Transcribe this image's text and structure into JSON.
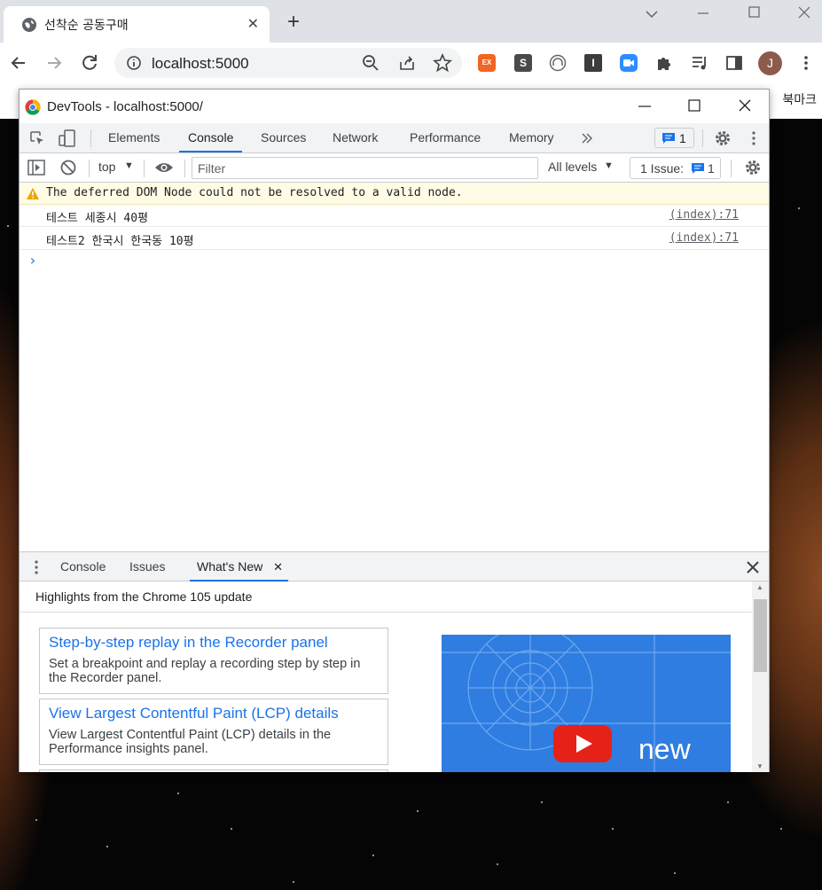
{
  "browser": {
    "tab_title": "선착순 공동구매",
    "url": "localhost:5000",
    "bookmarks_label": "북마크",
    "profile_initial": "J",
    "extension_ex_label": "EX",
    "extension_s_label": "S",
    "extension_i_label": "I"
  },
  "devtools": {
    "window_title": "DevTools - localhost:5000/",
    "tabs": [
      "Elements",
      "Console",
      "Sources",
      "Network",
      "Performance",
      "Memory"
    ],
    "active_tab": "Console",
    "messages_badge": "1",
    "context": "top",
    "filter_placeholder": "Filter",
    "levels": "All levels",
    "issues_label": "1 Issue:",
    "issues_count": "1",
    "console_messages": [
      {
        "type": "warning",
        "text": "The deferred DOM Node could not be resolved to a valid node.",
        "source": ""
      },
      {
        "type": "log",
        "text": "테스트 세종시 40평",
        "source": "(index):71"
      },
      {
        "type": "log",
        "text": "테스트2 한국시 한국동 10평",
        "source": "(index):71"
      }
    ],
    "drawer_tabs": [
      "Console",
      "Issues",
      "What's New"
    ],
    "drawer_active": "What's New",
    "whats_new": {
      "heading": "Highlights from the Chrome 105 update",
      "cards": [
        {
          "title": "Step-by-step replay in the Recorder panel",
          "desc": "Set a breakpoint and replay a recording step by step in the Recorder panel."
        },
        {
          "title": "View Largest Contentful Paint (LCP) details",
          "desc": "View Largest Contentful Paint (LCP) details in the Performance insights panel."
        }
      ],
      "video_caption": "new"
    }
  },
  "colors": {
    "accent": "#1a73e8",
    "warning_bg": "#fffbe5",
    "video_bg": "#2f7de0",
    "youtube_red": "#e62117"
  }
}
